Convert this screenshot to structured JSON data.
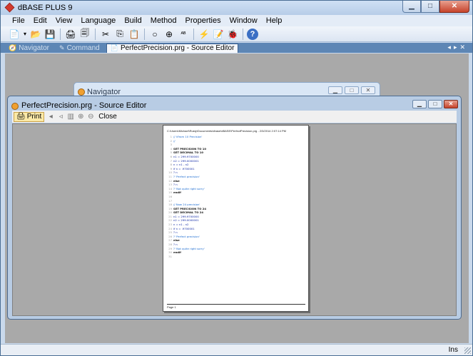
{
  "app": {
    "title": "dBASE PLUS 9"
  },
  "menubar": [
    "File",
    "Edit",
    "View",
    "Language",
    "Build",
    "Method",
    "Properties",
    "Window",
    "Help"
  ],
  "tabs": [
    {
      "label": "Navigator",
      "active": false,
      "icon": "navigator-icon"
    },
    {
      "label": "Command",
      "active": false,
      "icon": "command-icon"
    },
    {
      "label": "PerfectPrecision.prg - Source Editor",
      "active": true,
      "icon": "source-editor-icon"
    }
  ],
  "navigator_window": {
    "title": "Navigator"
  },
  "source_editor": {
    "title": "PerfectPrecision.prg - Source Editor",
    "print_label": "Print",
    "close_label": "Close"
  },
  "printout": {
    "header": "C:\\Users\\Michael\\Rusty\\Documents\\dbase\\dBASE\\PerfectPrecision.prg - 2/3/2014 2:07:14 PM",
    "footer": "Page 1",
    "lines": [
      {
        "n": "1",
        "t": "// Vfrom 10 Precision'",
        "k": "cm"
      },
      {
        "n": "2",
        "t": "//",
        "k": "cm"
      },
      {
        "n": "3",
        "t": "",
        "k": ""
      },
      {
        "n": "4",
        "t": "SET PRECISION TO 10",
        "k": "kw"
      },
      {
        "n": "5",
        "t": "SET DECIMAL TO   10",
        "k": "kw"
      },
      {
        "n": "6",
        "t": "n1 = 299.9700000",
        "k": ""
      },
      {
        "n": "7",
        "t": "n2 = 299.0000001",
        "k": ""
      },
      {
        "n": "8",
        "t": "n = n1 - n2",
        "k": ""
      },
      {
        "n": "9",
        "t": "if n = .9700001",
        "k": ""
      },
      {
        "n": "10",
        "t": "  ? n",
        "k": ""
      },
      {
        "n": "11",
        "t": "  ? 'Perfect precision'",
        "k": "cm"
      },
      {
        "n": "12",
        "t": "else",
        "k": "kw"
      },
      {
        "n": "13",
        "t": "  ? n",
        "k": ""
      },
      {
        "n": "14",
        "t": "  ? 'Not quite right sorry'",
        "k": "cm"
      },
      {
        "n": "15",
        "t": "endif",
        "k": "kw"
      },
      {
        "n": "16",
        "t": "",
        "k": ""
      },
      {
        "n": "17",
        "t": "",
        "k": ""
      },
      {
        "n": "18",
        "t": "// Now 24 precision'",
        "k": "cm"
      },
      {
        "n": "19",
        "t": "SET PRECISION TO 24",
        "k": "kw"
      },
      {
        "n": "20",
        "t": "SET DECIMAL TO 24",
        "k": "kw"
      },
      {
        "n": "21",
        "t": "n1 = 299.9700000",
        "k": ""
      },
      {
        "n": "22",
        "t": "n2 = 299.0000001",
        "k": ""
      },
      {
        "n": "23",
        "t": "n = n1 - n2",
        "k": ""
      },
      {
        "n": "24",
        "t": "if n = .9700001",
        "k": ""
      },
      {
        "n": "25",
        "t": "  ? n",
        "k": ""
      },
      {
        "n": "26",
        "t": "  ? 'Perfect precision'",
        "k": "cm"
      },
      {
        "n": "27",
        "t": "else",
        "k": "kw"
      },
      {
        "n": "28",
        "t": "  ? n",
        "k": ""
      },
      {
        "n": "29",
        "t": "  ? 'Not quite right sorry'",
        "k": "cm"
      },
      {
        "n": "30",
        "t": "endif",
        "k": "kw"
      },
      {
        "n": "31",
        "t": "",
        "k": ""
      }
    ]
  },
  "status": {
    "mode": "Ins"
  }
}
